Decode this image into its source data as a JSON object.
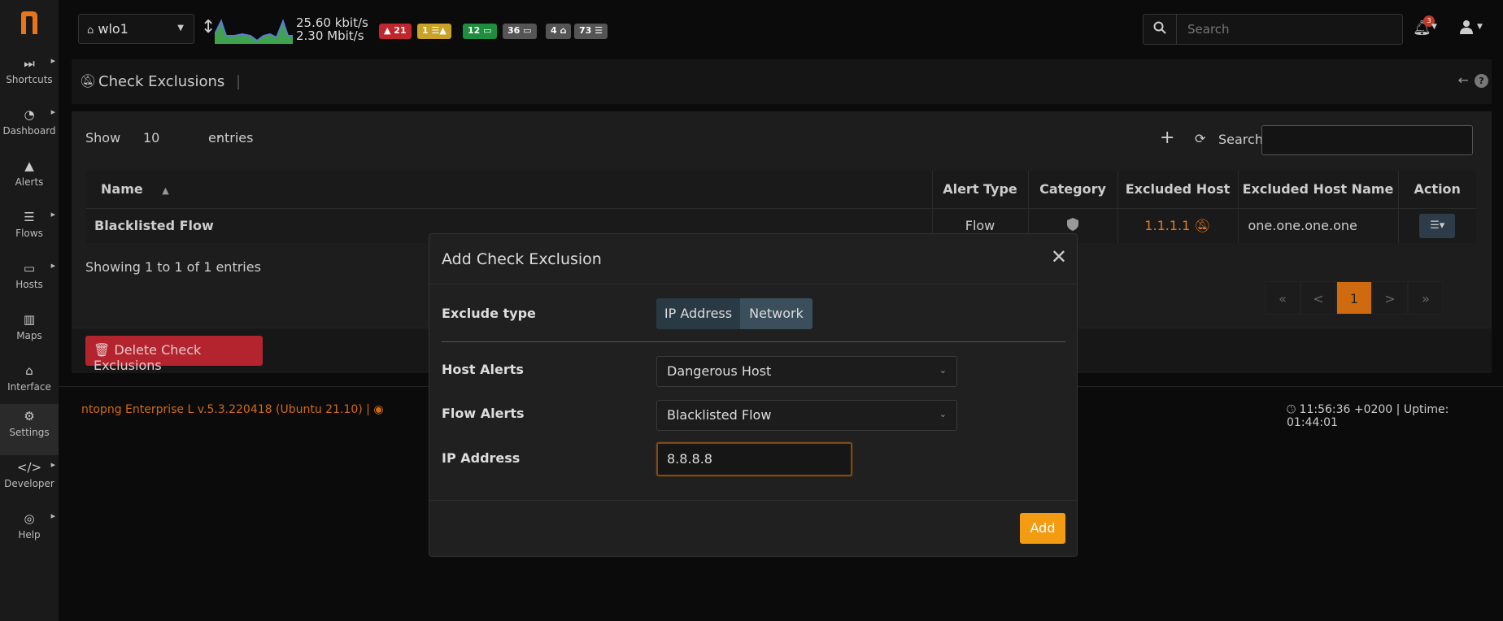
{
  "sidebar": {
    "logo": "n",
    "items": [
      {
        "label": "Shortcuts",
        "icon": "fast-forward-icon",
        "glyph": "⏭"
      },
      {
        "label": "Dashboard",
        "icon": "gauge-icon",
        "glyph": "◔"
      },
      {
        "label": "Alerts",
        "icon": "warning-icon",
        "glyph": "▲"
      },
      {
        "label": "Flows",
        "icon": "list-icon",
        "glyph": "☰"
      },
      {
        "label": "Hosts",
        "icon": "laptop-icon",
        "glyph": "▭"
      },
      {
        "label": "Maps",
        "icon": "map-icon",
        "glyph": "▥"
      },
      {
        "label": "Interface",
        "icon": "ethernet-icon",
        "glyph": "⌂"
      },
      {
        "label": "Settings",
        "icon": "gear-icon",
        "glyph": "⚙"
      },
      {
        "label": "Developer",
        "icon": "code-icon",
        "glyph": "</>"
      },
      {
        "label": "Help",
        "icon": "lifebuoy-icon",
        "glyph": "◎"
      }
    ]
  },
  "topbar": {
    "interface": "wlo1",
    "rate_up": "25.60 kbit/s",
    "rate_down": "2.30 Mbit/s",
    "badges": [
      {
        "text": "▲ 21",
        "color": "#c0272d"
      },
      {
        "text": "1 ☰▲",
        "color": "#c9a227"
      },
      {
        "text": "12 ▭",
        "color": "#1e8e3e"
      },
      {
        "text": "36 ▭",
        "color": "#555555"
      },
      {
        "text": "4 ⌂",
        "color": "#555555"
      },
      {
        "text": "73 ☰",
        "color": "#555555"
      }
    ],
    "search_placeholder": "Search",
    "notification_count": "3"
  },
  "page": {
    "title": "Check Exclusions",
    "separator": "|"
  },
  "table_controls": {
    "show_label": "Show",
    "show_value": "10",
    "entries_label": "entries",
    "search_label": "Search",
    "showing_text": "Showing 1 to 1 of 1 entries"
  },
  "table": {
    "columns": [
      "Name",
      "Alert Type",
      "Category",
      "Excluded Host",
      "Excluded Host Name",
      "Action"
    ],
    "sort_indicator": "▲",
    "rows": [
      {
        "name": "Blacklisted Flow",
        "alert_type": "Flow",
        "category_icon": "shield-icon",
        "excluded_host": "1.1.1.1",
        "excluded_host_name": "one.one.one.one",
        "action": "☰▾"
      }
    ]
  },
  "pagination": [
    "«",
    "<",
    "1",
    ">",
    "»"
  ],
  "delete_button": "Delete Check Exclusions",
  "footer": {
    "version": "ntopng Enterprise L v.5.3.220418 (Ubuntu 21.10) |",
    "time": "11:56:36 +0200 | Uptime: 01:44:01"
  },
  "modal": {
    "title": "Add Check Exclusion",
    "exclude_type_label": "Exclude type",
    "exclude_options": [
      "IP Address",
      "Network"
    ],
    "host_alerts_label": "Host Alerts",
    "host_alerts_value": "Dangerous Host",
    "flow_alerts_label": "Flow Alerts",
    "flow_alerts_value": "Blacklisted Flow",
    "ip_label": "IP Address",
    "ip_value": "8.8.8.8",
    "add_button": "Add"
  },
  "colors": {
    "accent": "#f39c12",
    "danger": "#b3242e",
    "host_link": "#e0791f"
  }
}
